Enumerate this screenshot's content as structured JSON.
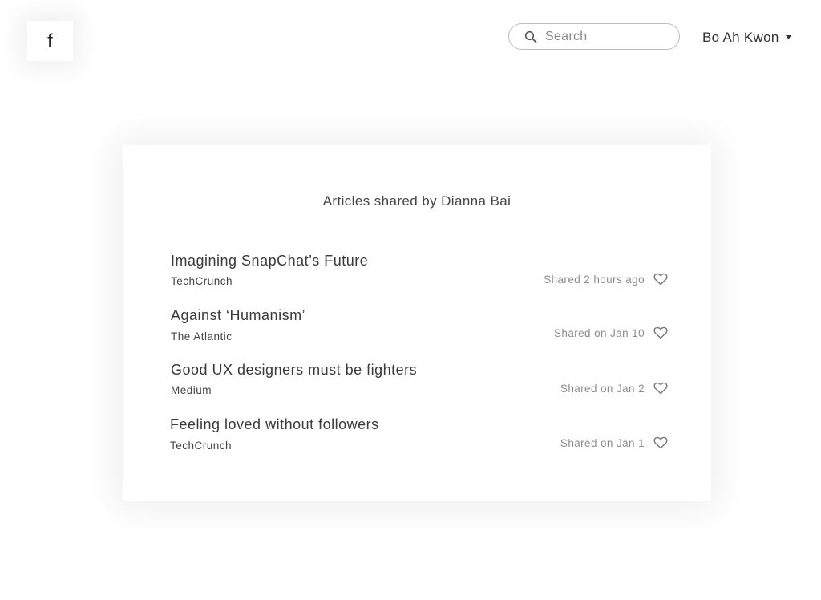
{
  "header": {
    "logo_letter": "f",
    "search": {
      "placeholder": "Search",
      "value": ""
    },
    "user": {
      "name": "Bo Ah Kwon"
    }
  },
  "card": {
    "title": "Articles shared by Dianna Bai",
    "articles": [
      {
        "title": "Imagining SnapChat’s Future",
        "source": "TechCrunch",
        "shared": "Shared 2 hours ago"
      },
      {
        "title": "Against ‘Humanism’",
        "source": "The Atlantic",
        "shared": "Shared on Jan 10"
      },
      {
        "title": "Good UX designers must be fighters",
        "source": "Medium",
        "shared": "Shared on Jan 2"
      },
      {
        "title": "Feeling loved without followers",
        "source": "TechCrunch",
        "shared": "Shared on Jan 1"
      }
    ]
  },
  "icons": {
    "search": "search-icon",
    "caret": "caret-down-icon",
    "like": "heart-icon"
  },
  "colors": {
    "text": "#333333",
    "muted": "#8c8c8c",
    "border": "#bdbdbd",
    "background": "#ffffff"
  }
}
